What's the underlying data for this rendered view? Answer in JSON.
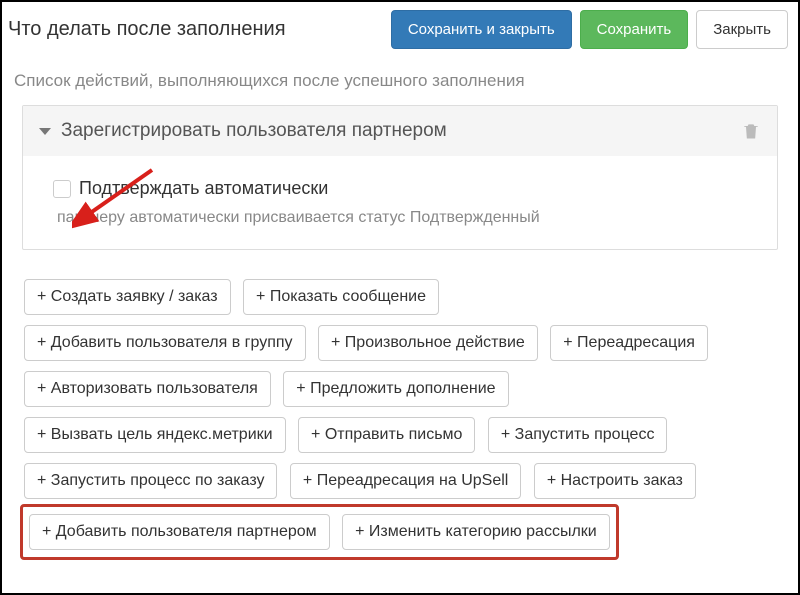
{
  "header": {
    "title": "Что делать после заполнения",
    "save_close": "Сохранить и закрыть",
    "save": "Сохранить",
    "close": "Закрыть"
  },
  "subtitle": "Список действий, выполняющихся после успешного заполнения",
  "card": {
    "title": "Зарегистрировать пользователя партнером",
    "checkbox_label": "Подтверждать автоматически",
    "hint": "партнеру автоматически присваивается статус Подтвержденный"
  },
  "actions": {
    "row1": [
      "+ Создать заявку / заказ",
      "+ Показать сообщение"
    ],
    "row2": [
      "+ Добавить пользователя в группу",
      "+ Произвольное действие",
      "+ Переадресация"
    ],
    "row3": [
      "+ Авторизовать пользователя",
      "+ Предложить дополнение"
    ],
    "row4": [
      "+ Вызвать цель яндекс.метрики",
      "+ Отправить письмо",
      "+ Запустить процесс"
    ],
    "row5": [
      "+ Запустить процесс по заказу",
      "+ Переадресация на UpSell",
      "+ Настроить заказ"
    ],
    "row6": [
      "+ Добавить пользователя партнером",
      "+ Изменить категорию рассылки"
    ]
  }
}
